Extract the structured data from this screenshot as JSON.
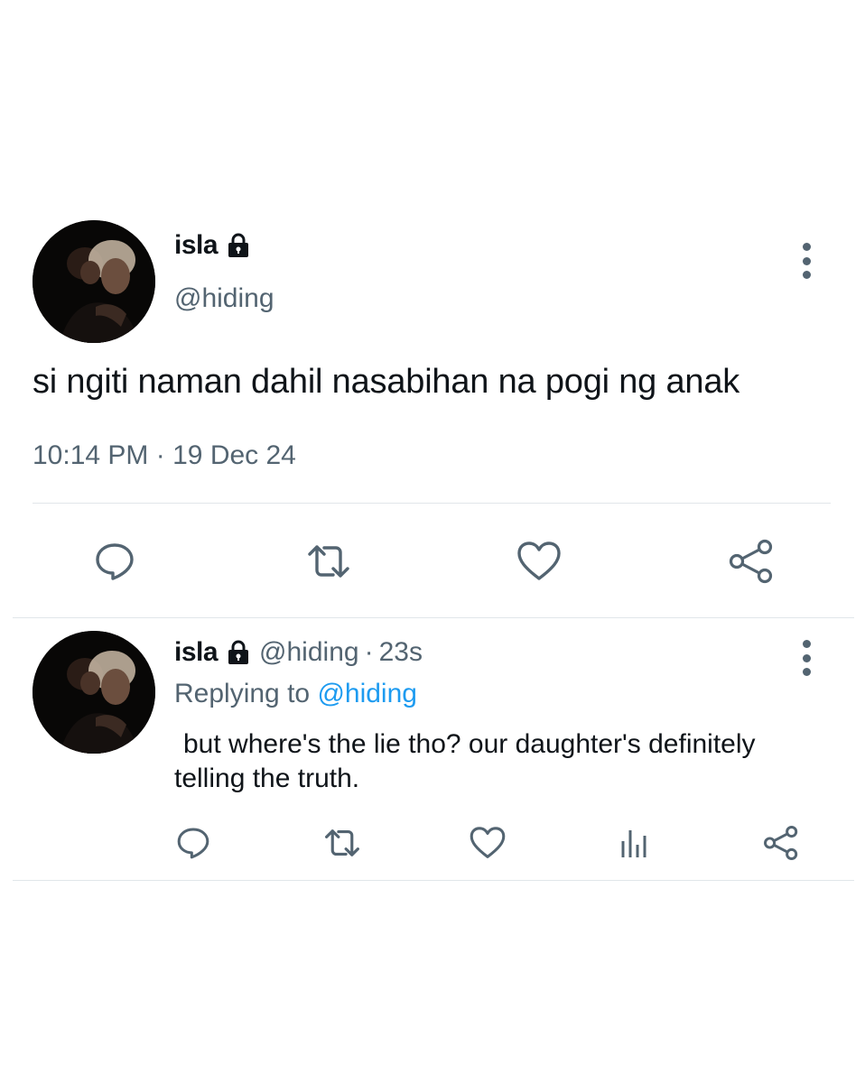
{
  "tweet": {
    "author": {
      "name": "isla",
      "handle": "@hiding",
      "locked_icon": "lock-icon"
    },
    "text": "si ngiti naman dahil nasabihan na pogi ng anak",
    "time": "10:14 PM",
    "separator": "·",
    "date": "19 Dec 24",
    "actions": [
      "reply-icon",
      "retweet-icon",
      "like-icon",
      "share-icon"
    ]
  },
  "reply": {
    "author": {
      "name": "isla",
      "handle": "@hiding",
      "locked_icon": "lock-icon"
    },
    "separator": "·",
    "time_ago": "23s",
    "replying_prefix": "Replying to",
    "replying_to": "@hiding",
    "text": "but where's the lie tho? our daughter's definitely telling the truth.",
    "actions": [
      "reply-icon",
      "retweet-icon",
      "like-icon",
      "analytics-icon",
      "share-icon"
    ]
  },
  "colors": {
    "text": "#0f1419",
    "secondary": "#536471",
    "link": "#1d9bf0",
    "divider": "#e1e6ea"
  }
}
